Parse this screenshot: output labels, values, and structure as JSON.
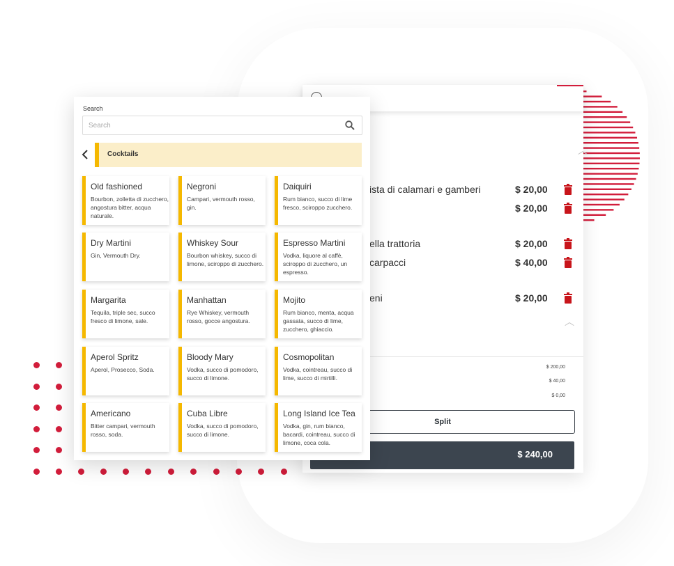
{
  "menu": {
    "search_label": "Search",
    "search_placeholder": "Search",
    "category": "Cocktails",
    "items": [
      {
        "name": "Old fashioned",
        "desc": "Bourbon, zolletta di zucchero, angostura bitter, acqua naturale."
      },
      {
        "name": "Negroni",
        "desc": "Campari, vermouth rosso, gin."
      },
      {
        "name": "Daiquiri",
        "desc": "Rum bianco, succo di lime fresco, sciroppo zucchero."
      },
      {
        "name": "Dry Martini",
        "desc": "Gin, Vermouth Dry."
      },
      {
        "name": "Whiskey Sour",
        "desc": "Bourbon whiskey, succo di limone, sciroppo di zucchero."
      },
      {
        "name": "Espresso Martini",
        "desc": "Vodka, liquore al caffè, sciroppo di zucchero, un espresso."
      },
      {
        "name": "Margarita",
        "desc": "Tequila, triple sec, succo fresco di limone, sale."
      },
      {
        "name": "Manhattan",
        "desc": "Rye Whiskey, vermouth rosso, gocce angostura."
      },
      {
        "name": "Mojito",
        "desc": "Rum bianco, menta, acqua gassata, succo di lime, zucchero, ghiaccio."
      },
      {
        "name": "Aperol Spritz",
        "desc": "Aperol, Prosecco, Soda."
      },
      {
        "name": "Bloody Mary",
        "desc": "Vodka, succo di pomodoro, succo di limone."
      },
      {
        "name": "Cosmopolitan",
        "desc": "Vodka, cointreau, succo di lime, succo di mirtilli."
      },
      {
        "name": "Americano",
        "desc": "Bitter campari, vermouth rosso, soda."
      },
      {
        "name": "Cuba Libre",
        "desc": "Vodka, succo di pomodoro, succo di limone."
      },
      {
        "name": "Long Island Ice Tea",
        "desc": "Vodka, gin, rum bianco, bacardi, cointreau, succo di limone, coca cola."
      }
    ]
  },
  "order": {
    "items": [
      {
        "name": "ista di calamari e gamberi",
        "price": "$ 20,00"
      },
      {
        "name": "",
        "price": "$ 20,00"
      },
      {
        "name": "ella trattoria",
        "price": "$ 20,00"
      },
      {
        "name": "carpacci",
        "price": "$ 40,00"
      },
      {
        "name": "eni",
        "price": "$ 20,00"
      }
    ],
    "summary": [
      "$ 200,00",
      "$ 40,00",
      "$ 0,00"
    ],
    "split_label": "Split",
    "total": "$ 240,00"
  },
  "colors": {
    "accent": "#f5b800",
    "brand_red": "#d21d3b",
    "dark": "#3c454f",
    "category_bg": "#fbeec9"
  }
}
